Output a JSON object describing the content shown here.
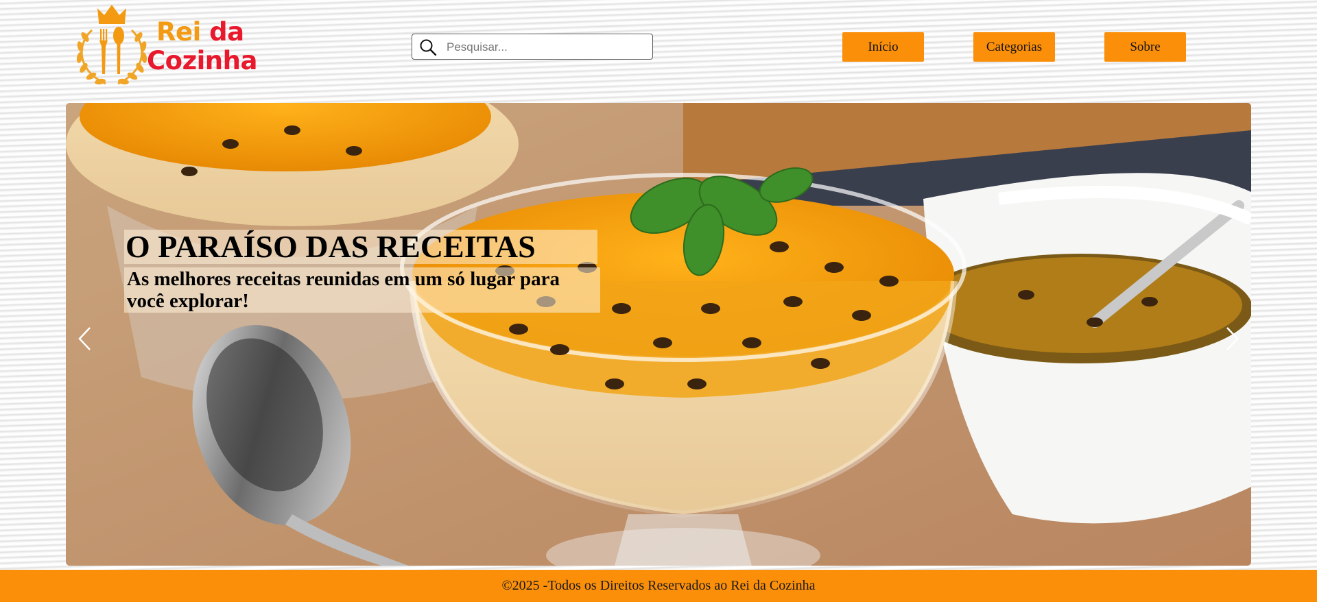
{
  "header": {
    "logo": {
      "word_rei": "Rei",
      "word_da": "da",
      "word_cozinha": "Cozinha"
    },
    "search": {
      "placeholder": "Pesquisar...",
      "value": "",
      "icon": "search-icon"
    },
    "nav": [
      {
        "label": "Início"
      },
      {
        "label": "Categorias"
      },
      {
        "label": "Sobre"
      }
    ]
  },
  "hero": {
    "title": "O PARAÍSO DAS RECEITAS",
    "subtitle": "As melhores receitas reunidas em um só lugar para você explorar!",
    "prev_icon": "chevron-left-icon",
    "next_icon": "chevron-right-icon"
  },
  "footer": {
    "text": "©2025 -Todos os Direitos Reservados ao Rei da Cozinha"
  },
  "colors": {
    "accent_orange": "#fb8f0a",
    "logo_orange": "#f39a12",
    "logo_red": "#e8192c"
  }
}
